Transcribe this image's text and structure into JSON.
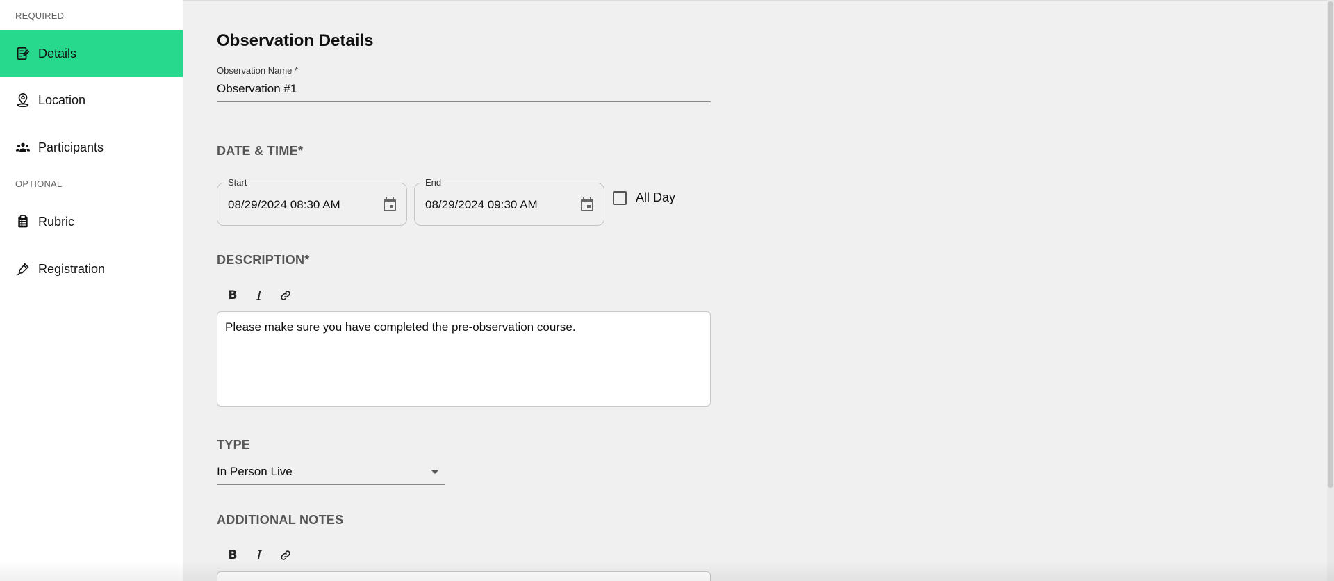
{
  "sidebar": {
    "required_label": "REQUIRED",
    "optional_label": "OPTIONAL",
    "items": [
      {
        "label": "Details",
        "icon": "notes-icon",
        "active": true
      },
      {
        "label": "Location",
        "icon": "location-pin-icon"
      },
      {
        "label": "Participants",
        "icon": "group-icon"
      },
      {
        "label": "Rubric",
        "icon": "clipboard-icon"
      },
      {
        "label": "Registration",
        "icon": "pen-signature-icon"
      }
    ]
  },
  "main": {
    "title": "Observation Details",
    "observation_name": {
      "label": "Observation Name *",
      "value": "Observation #1"
    },
    "datetime": {
      "heading": "DATE & TIME*",
      "start": {
        "legend": "Start",
        "value": "08/29/2024 08:30 AM"
      },
      "end": {
        "legend": "End",
        "value": "08/29/2024 09:30 AM"
      },
      "all_day": {
        "label": "All Day",
        "checked": false
      }
    },
    "description": {
      "heading": "DESCRIPTION*",
      "toolbar": {
        "bold": "B",
        "italic": "I"
      },
      "text": "Please make sure you have completed the pre-observation course."
    },
    "type": {
      "heading": "TYPE",
      "selected": "In Person Live"
    },
    "additional_notes": {
      "heading": "ADDITIONAL NOTES",
      "toolbar": {
        "bold": "B",
        "italic": "I"
      }
    }
  },
  "colors": {
    "accent": "#26d98c",
    "background": "#f0f0f0",
    "sidebar": "#ffffff"
  }
}
